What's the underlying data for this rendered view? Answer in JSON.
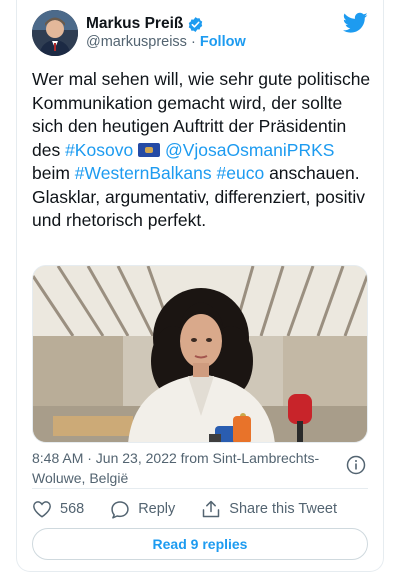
{
  "author": {
    "name": "Markus Preiß",
    "handle": "@markuspreiss",
    "separator": "·",
    "follow_label": "Follow"
  },
  "tweet": {
    "text_1": "Wer mal sehen will, wie sehr gute politische Kommunikation gemacht wird, der sollte sich den heutigen Auftritt der Präsidentin des ",
    "hashtag_kosovo": "#Kosovo",
    "mention": "@VjosaOsmaniPRKS",
    "text_2": " beim ",
    "hashtag_wb": "#WesternBalkans",
    "hashtag_euco": "#euco",
    "text_3": " anschauen. Glasklar, argumentativ, differenziert, positiv und rhetorisch perfekt."
  },
  "meta": {
    "timestamp": "8:48 AM · Jun 23, 2022 from Sint-Lambrechts-Woluwe, België"
  },
  "actions": {
    "likes": "568",
    "reply_label": "Reply",
    "share_label": "Share this Tweet"
  },
  "replies_button": "Read 9 replies",
  "colors": {
    "accent": "#1d9bf0",
    "text": "#0f1419",
    "secondary": "#536471",
    "border": "#e6ecf0"
  },
  "icons": [
    "verified-badge-icon",
    "twitter-bird-icon",
    "kosovo-flag-icon",
    "info-icon",
    "heart-icon",
    "reply-icon",
    "share-icon"
  ]
}
